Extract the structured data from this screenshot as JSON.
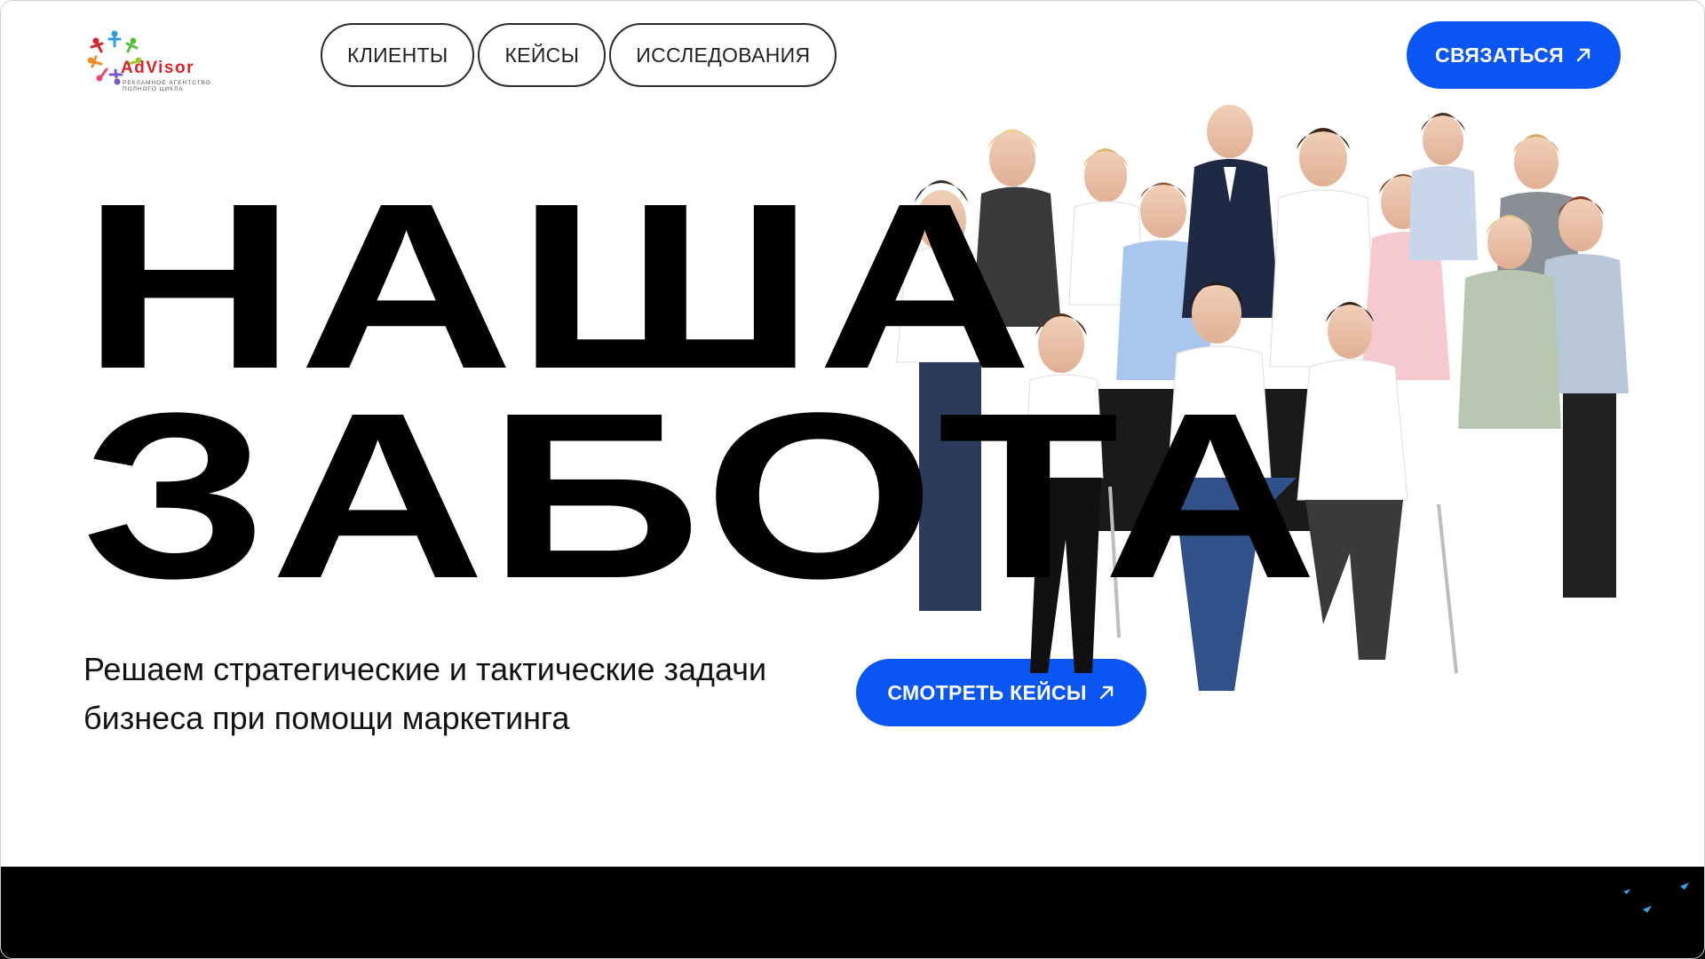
{
  "logo": {
    "brand": "AdVisor",
    "tagline": "Рекламное агентство полного цикла"
  },
  "nav": {
    "items": [
      {
        "label": "КЛИЕНТЫ"
      },
      {
        "label": "КЕЙСЫ"
      },
      {
        "label": "ИССЛЕДОВАНИЯ"
      }
    ]
  },
  "header": {
    "contact_label": "СВЯЗАТЬСЯ"
  },
  "hero": {
    "title_line1": "НАША",
    "title_line2": "ЗАБОТА",
    "subtitle": "Решаем стратегические и тактические задачи бизнеса при помощи маркетинга",
    "cases_label": "СМОТРЕТЬ КЕЙСЫ"
  },
  "colors": {
    "accent": "#0a56f5",
    "brand_red": "#d8232a",
    "text": "#000000",
    "band": "#000000"
  },
  "icons": {
    "contact_arrow": "arrow-up-right-icon",
    "cases_arrow": "arrow-up-right-icon",
    "logo_mark": "people-circle-logo-icon"
  }
}
